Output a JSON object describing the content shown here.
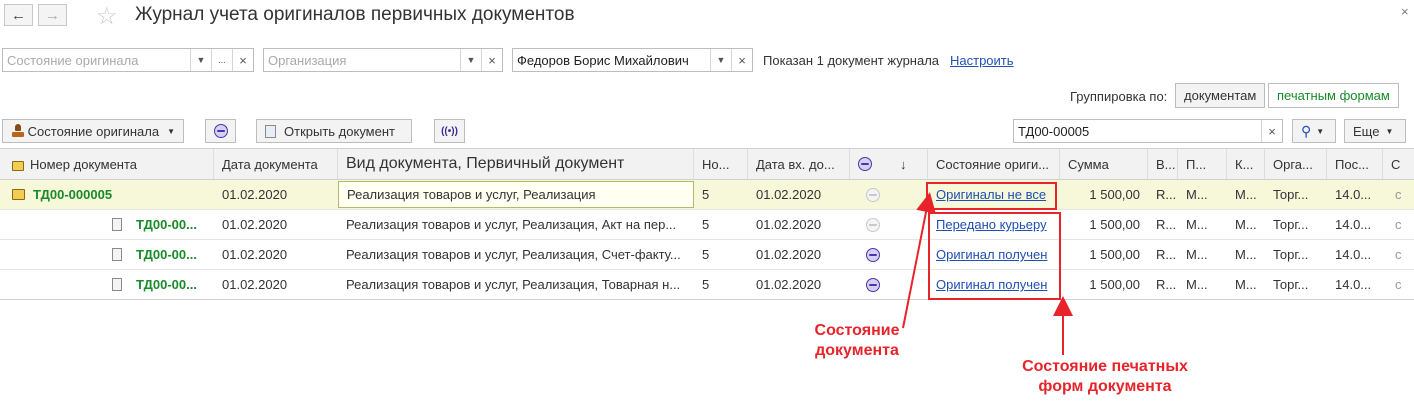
{
  "window": {
    "title": "Журнал учета оригиналов первичных документов",
    "close_symbol": "×"
  },
  "filters": {
    "state_placeholder": "Состояние оригинала",
    "org_placeholder": "Организация",
    "responsible_value": "Федоров Борис Михайлович",
    "more_symbol": "...",
    "clear_symbol": "×",
    "dropdown_symbol": "▼",
    "shown_text": "Показан 1 документ журнала",
    "configure_link": "Настроить"
  },
  "grouping": {
    "label": "Группировка по:",
    "option_documents": "документам",
    "option_print_forms": "печатным формам",
    "selected_color": "#1a8a2a"
  },
  "toolbar": {
    "state_button": "Состояние оригинала",
    "open_button": "Открыть документ",
    "search_value": "ТД00-00005",
    "more_button": "Еще",
    "scan_symbol": "((•))"
  },
  "columns": {
    "doc_number": "Номер документа",
    "doc_date": "Дата документа",
    "doc_kind": "Вид документа, Первичный документ",
    "number_short": "Но...",
    "in_date": "Дата вх. до...",
    "sort_arrow": "↓",
    "original_state": "Состояние ориги...",
    "sum": "Сумма",
    "c1": "В...",
    "c2": "П...",
    "c3": "К...",
    "c4": "Орга...",
    "c5": "Пос...",
    "c6": "С"
  },
  "rows": [
    {
      "number": "ТД00-000005",
      "date": "01.02.2020",
      "kind": "Реализация товаров и услуг, Реализация",
      "n": "5",
      "in_date": "01.02.2020",
      "state": "Оригиналы не все",
      "sum": "1 500,00",
      "c1": "R...",
      "c2": "M...",
      "c3": "M...",
      "c4": "Торг...",
      "c5": "14.0..."
    },
    {
      "number": "ТД00-00...",
      "date": "01.02.2020",
      "kind": "Реализация товаров и услуг, Реализация, Акт на пер...",
      "n": "5",
      "in_date": "01.02.2020",
      "state": "Передано курьеру",
      "sum": "1 500,00",
      "c1": "R...",
      "c2": "M...",
      "c3": "M...",
      "c4": "Торг...",
      "c5": "14.0..."
    },
    {
      "number": "ТД00-00...",
      "date": "01.02.2020",
      "kind": "Реализация товаров и услуг, Реализация, Счет-факту...",
      "n": "5",
      "in_date": "01.02.2020",
      "state": "Оригинал получен",
      "sum": "1 500,00",
      "c1": "R...",
      "c2": "M...",
      "c3": "M...",
      "c4": "Торг...",
      "c5": "14.0..."
    },
    {
      "number": "ТД00-00...",
      "date": "01.02.2020",
      "kind": "Реализация товаров и услуг, Реализация, Товарная н...",
      "n": "5",
      "in_date": "01.02.2020",
      "state": "Оригинал получен",
      "sum": "1 500,00",
      "c1": "R...",
      "c2": "M...",
      "c3": "M...",
      "c4": "Торг...",
      "c5": "14.0..."
    }
  ],
  "annotations": {
    "doc_state_line1": "Состояние",
    "doc_state_line2": "документа",
    "print_state_line1": "Состояние печатных",
    "print_state_line2": "форм документа",
    "color": "#e8242a"
  }
}
